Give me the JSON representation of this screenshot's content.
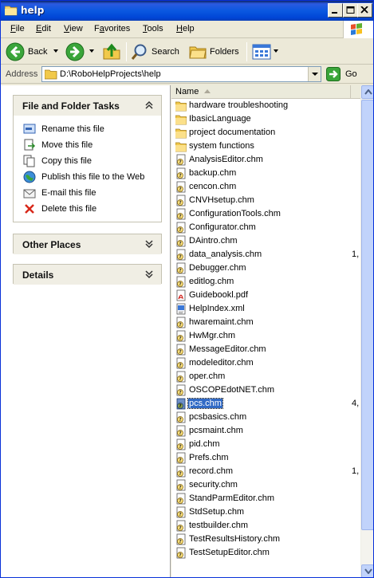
{
  "window": {
    "title": "help"
  },
  "menu": {
    "items": [
      {
        "pre": "",
        "ul": "F",
        "post": "ile"
      },
      {
        "pre": "",
        "ul": "E",
        "post": "dit"
      },
      {
        "pre": "",
        "ul": "V",
        "post": "iew"
      },
      {
        "pre": "F",
        "ul": "a",
        "post": "vorites"
      },
      {
        "pre": "",
        "ul": "T",
        "post": "ools"
      },
      {
        "pre": "",
        "ul": "H",
        "post": "elp"
      }
    ]
  },
  "toolbar": {
    "back_label": "Back",
    "search_label": "Search",
    "folders_label": "Folders"
  },
  "address": {
    "label": "Address",
    "value": "D:\\RoboHelpProjects\\help",
    "go_label": "Go"
  },
  "left_pane": {
    "file_tasks": {
      "title": "File and Folder Tasks",
      "items": [
        {
          "label": "Rename this file",
          "icon": "rename-icon"
        },
        {
          "label": "Move this file",
          "icon": "move-icon"
        },
        {
          "label": "Copy this file",
          "icon": "copy-icon"
        },
        {
          "label": "Publish this file to the Web",
          "icon": "globe-icon"
        },
        {
          "label": "E-mail this file",
          "icon": "email-icon"
        },
        {
          "label": "Delete this file",
          "icon": "delete-icon"
        }
      ]
    },
    "other_places": {
      "title": "Other Places"
    },
    "details": {
      "title": "Details"
    }
  },
  "file_list": {
    "column_name": "Name",
    "selected": "pcs.chm",
    "files": [
      {
        "name": "hardware troubleshooting",
        "type": "folder",
        "size": ""
      },
      {
        "name": "IbasicLanguage",
        "type": "folder",
        "size": ""
      },
      {
        "name": "project documentation",
        "type": "folder",
        "size": ""
      },
      {
        "name": "system functions",
        "type": "folder",
        "size": ""
      },
      {
        "name": "AnalysisEditor.chm",
        "type": "chm",
        "size": ""
      },
      {
        "name": "backup.chm",
        "type": "chm",
        "size": ""
      },
      {
        "name": "cencon.chm",
        "type": "chm",
        "size": ""
      },
      {
        "name": "CNVHsetup.chm",
        "type": "chm",
        "size": ""
      },
      {
        "name": "ConfigurationTools.chm",
        "type": "chm",
        "size": ""
      },
      {
        "name": "Configurator.chm",
        "type": "chm",
        "size": ""
      },
      {
        "name": "DAintro.chm",
        "type": "chm",
        "size": ""
      },
      {
        "name": "data_analysis.chm",
        "type": "chm",
        "size": "1,"
      },
      {
        "name": "Debugger.chm",
        "type": "chm",
        "size": ""
      },
      {
        "name": "editlog.chm",
        "type": "chm",
        "size": ""
      },
      {
        "name": "Guidebookl.pdf",
        "type": "pdf",
        "size": ""
      },
      {
        "name": "HelpIndex.xml",
        "type": "xml",
        "size": ""
      },
      {
        "name": "hwaremaint.chm",
        "type": "chm",
        "size": ""
      },
      {
        "name": "HwMgr.chm",
        "type": "chm",
        "size": ""
      },
      {
        "name": "MessageEditor.chm",
        "type": "chm",
        "size": ""
      },
      {
        "name": "modeleditor.chm",
        "type": "chm",
        "size": ""
      },
      {
        "name": "oper.chm",
        "type": "chm",
        "size": ""
      },
      {
        "name": "OSCOPEdotNET.chm",
        "type": "chm",
        "size": ""
      },
      {
        "name": "pcs.chm",
        "type": "chm",
        "size": "4,"
      },
      {
        "name": "pcsbasics.chm",
        "type": "chm",
        "size": ""
      },
      {
        "name": "pcsmaint.chm",
        "type": "chm",
        "size": ""
      },
      {
        "name": "pid.chm",
        "type": "chm",
        "size": ""
      },
      {
        "name": "Prefs.chm",
        "type": "chm",
        "size": ""
      },
      {
        "name": "record.chm",
        "type": "chm",
        "size": "1,"
      },
      {
        "name": "security.chm",
        "type": "chm",
        "size": ""
      },
      {
        "name": "StandParmEditor.chm",
        "type": "chm",
        "size": ""
      },
      {
        "name": "StdSetup.chm",
        "type": "chm",
        "size": ""
      },
      {
        "name": "testbuilder.chm",
        "type": "chm",
        "size": ""
      },
      {
        "name": "TestResultsHistory.chm",
        "type": "chm",
        "size": ""
      },
      {
        "name": "TestSetupEditor.chm",
        "type": "chm",
        "size": ""
      }
    ]
  },
  "colors": {
    "titlebar": "#0a58e0",
    "selection": "#316ac5",
    "panel_header": "#f0eee4"
  }
}
